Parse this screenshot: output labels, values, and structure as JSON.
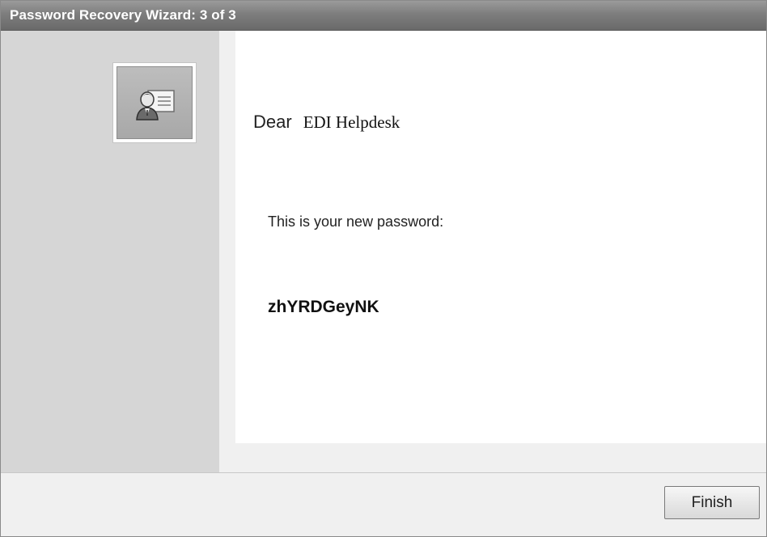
{
  "window": {
    "title": "Password Recovery Wizard: 3 of 3"
  },
  "sidebar": {
    "icon": "user-card-icon"
  },
  "content": {
    "dear_label": "Dear",
    "recipient_name": "EDI Helpdesk",
    "message": "This is your new password:",
    "new_password": "zhYRDGeyNK"
  },
  "footer": {
    "finish_label": "Finish"
  },
  "colors": {
    "titlebar": "#7d7d7d",
    "sidebar": "#d6d6d6",
    "content_background": "#ffffff",
    "footer": "#f0f0f0"
  }
}
